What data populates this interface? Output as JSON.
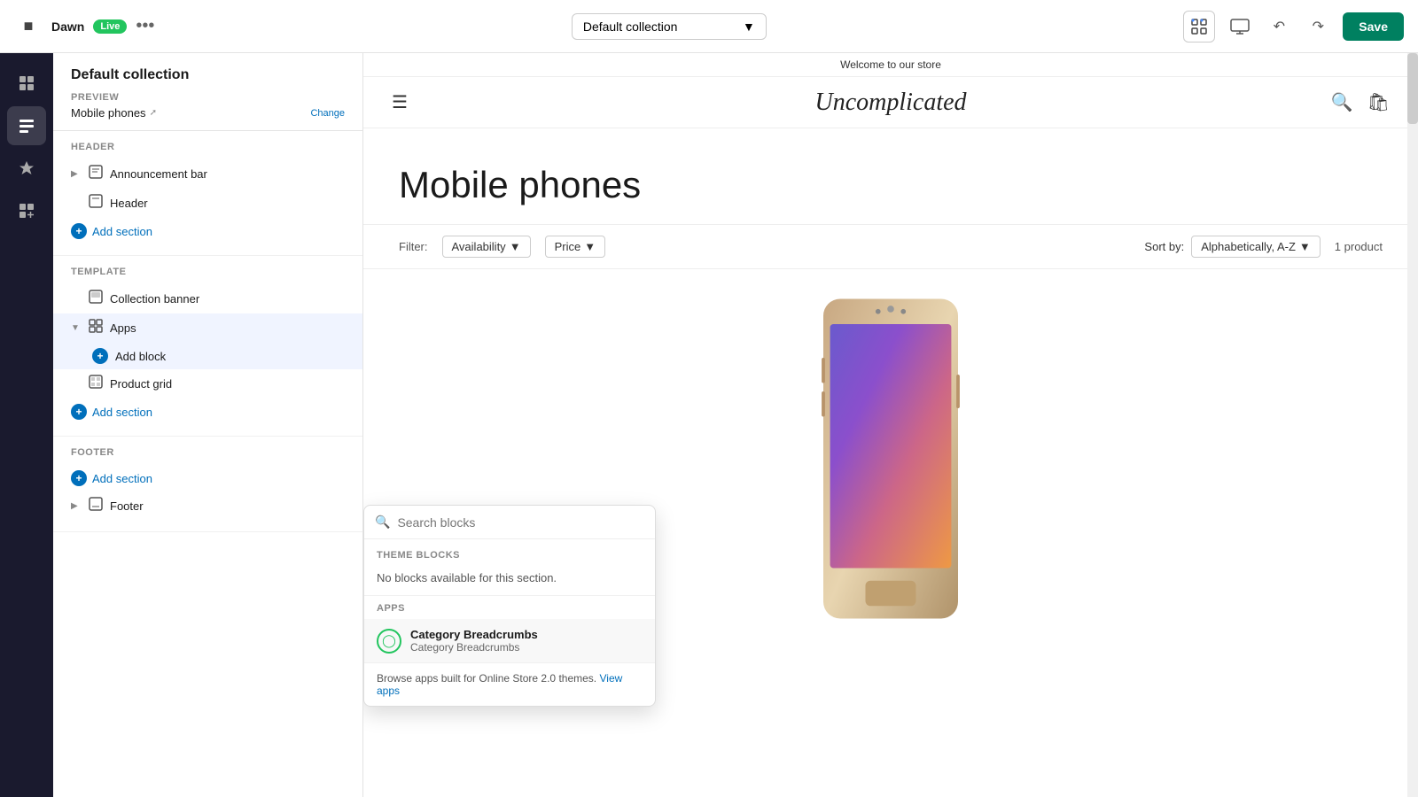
{
  "topbar": {
    "store_name": "Dawn",
    "live_label": "Live",
    "more_icon": "•••",
    "collection_selector": "Default collection",
    "save_label": "Save"
  },
  "panel": {
    "title": "Default collection",
    "preview_label": "PREVIEW",
    "preview_value": "Mobile phones",
    "change_label": "Change",
    "header_label": "HEADER",
    "announcement_bar_label": "Announcement bar",
    "header_label2": "Header",
    "add_section_label": "Add section",
    "template_label": "TEMPLATE",
    "collection_banner_label": "Collection banner",
    "apps_label": "Apps",
    "add_block_label": "Add block",
    "product_grid_label": "Product grid",
    "add_section_label2": "Add section",
    "footer_label": "FOOTER",
    "add_section_footer_label": "Add section",
    "footer_item_label": "Footer"
  },
  "preview": {
    "welcome_text": "Welcome to our store",
    "logo_text": "Uncomplicated",
    "page_title": "Mobile phones",
    "filter_label": "Filter:",
    "availability_label": "Availability",
    "price_label": "Price",
    "sort_label": "Sort by:",
    "sort_value": "Alphabetically, A-Z",
    "product_count": "1 product"
  },
  "popup": {
    "search_placeholder": "Search blocks",
    "theme_blocks_label": "THEME BLOCKS",
    "no_blocks_text": "No blocks available for this section.",
    "apps_label": "APPS",
    "app_name": "Category Breadcrumbs",
    "app_desc": "Category Breadcrumbs",
    "footer_text": "Browse apps built for Online Store 2.0 themes.",
    "view_apps_label": "View apps"
  }
}
